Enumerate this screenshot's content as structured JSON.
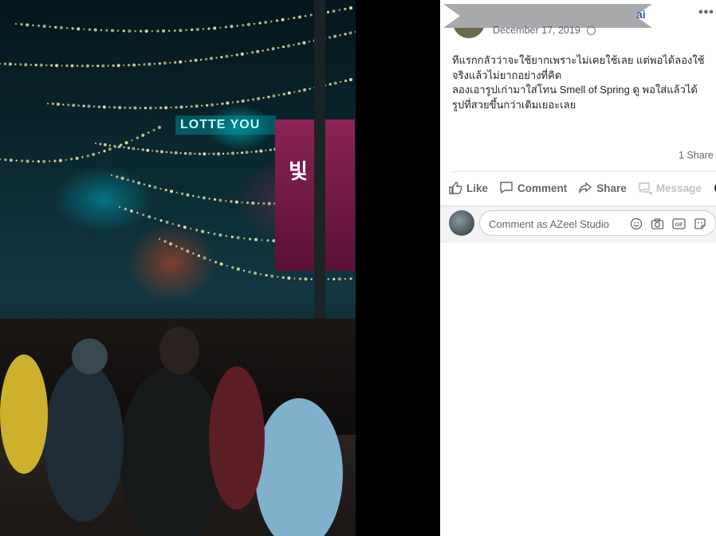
{
  "post": {
    "author_suffix": "ai",
    "date": "December 17, 2019",
    "more_label": "•••",
    "text_lines": [
      "ทีแรกกลัวว่าจะใช้ยากเพราะไม่เคยใช้เลย แต่พอได้ลองใช้",
      "จริงแล้วไม่ยากอย่างที่คิด",
      "ลองเอารูปเก่ามาใส่โทน Smell of Spring ดู พอใส่แล้วได้",
      "รูปที่สวยขึ้นกว่าเดิมเยอะเลย"
    ],
    "shares": "1 Share"
  },
  "actions": {
    "like": "Like",
    "comment": "Comment",
    "share": "Share",
    "message": "Message"
  },
  "comment_box": {
    "placeholder": "Comment as AZeel Studio"
  },
  "photo": {
    "sign_text": "LOTTE YOU",
    "banner_text": "빛"
  },
  "colors": {
    "link": "#365899",
    "muted": "#616770",
    "text": "#1d2129"
  }
}
